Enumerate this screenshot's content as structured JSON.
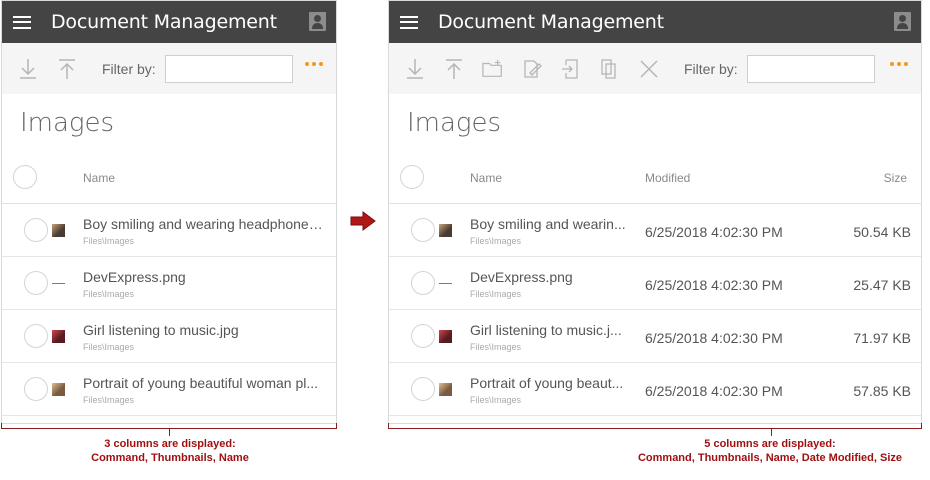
{
  "app_title": "Document Management",
  "filter_label": "Filter by:",
  "section_title": "Images",
  "columns": {
    "name": "Name",
    "modified": "Modified",
    "size": "Size"
  },
  "files": [
    {
      "name": "Boy smiling and wearing headphones...",
      "name_short": "Boy smiling and wearin...",
      "path": "Files\\Images",
      "modified": "6/25/2018 4:02:30 PM",
      "size": "50.54 KB"
    },
    {
      "name": "DevExpress.png",
      "name_short": "DevExpress.png",
      "path": "Files\\Images",
      "modified": "6/25/2018 4:02:30 PM",
      "size": "25.47 KB"
    },
    {
      "name": "Girl listening to music.jpg",
      "name_short": "Girl listening to music.j...",
      "path": "Files\\Images",
      "modified": "6/25/2018 4:02:30 PM",
      "size": "71.97 KB"
    },
    {
      "name": "Portrait of young beautiful woman pl...",
      "name_short": "Portrait of young beaut...",
      "path": "Files\\Images",
      "modified": "6/25/2018 4:02:30 PM",
      "size": "57.85 KB"
    }
  ],
  "captions": {
    "left_line1": "3 columns are displayed:",
    "left_line2": "Command, Thumbnails, Name",
    "right_line1": "5 columns are displayed:",
    "right_line2": "Command, Thumbnails, Name, Date Modified, Size"
  },
  "colors": {
    "titlebar": "#444444",
    "accent": "#f7941d",
    "annotation": "#a01010"
  },
  "icons": [
    "menu-icon",
    "user-icon",
    "download-icon",
    "upload-icon",
    "new-folder-icon",
    "rename-icon",
    "move-icon",
    "copy-icon",
    "delete-icon",
    "more-icon",
    "arrow-right-icon"
  ]
}
